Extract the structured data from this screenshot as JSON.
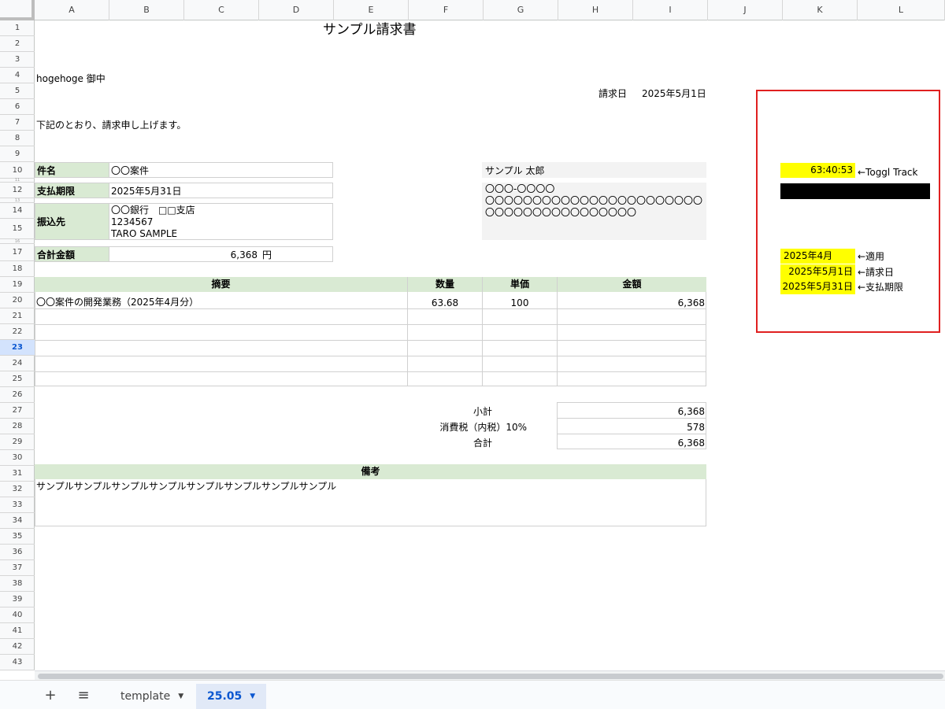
{
  "columns": [
    "A",
    "B",
    "C",
    "D",
    "E",
    "F",
    "G",
    "H",
    "I",
    "J",
    "K",
    "L"
  ],
  "rows": [
    "1",
    "2",
    "3",
    "4",
    "5",
    "6",
    "7",
    "8",
    "9",
    "10",
    "11",
    "12",
    "13",
    "14",
    "15",
    "16",
    "17",
    "18",
    "19",
    "20",
    "21",
    "22",
    "23",
    "24",
    "25",
    "26",
    "27",
    "28",
    "29",
    "30",
    "31",
    "32",
    "33",
    "34",
    "35",
    "36",
    "37",
    "38",
    "39",
    "40",
    "41",
    "42",
    "43"
  ],
  "selected_row": "23",
  "invoice": {
    "title": "サンプル請求書",
    "addressee": "hogehoge 御中",
    "date_label": "請求日",
    "date_value": "2025年5月1日",
    "intro": "下記のとおり、請求申し上げます。",
    "subject_label": "件名",
    "subject_value": "〇〇案件",
    "due_label": "支払期限",
    "due_value": "2025年5月31日",
    "bank_label": "振込先",
    "bank_line1": "〇〇銀行　□□支店",
    "bank_line2": "1234567",
    "bank_line3": "TARO SAMPLE",
    "total_label": "合計金額",
    "total_value": "6,368",
    "total_unit": "円",
    "issuer_name": "サンプル 太郎",
    "issuer_addr1": "〇〇〇-〇〇〇〇",
    "issuer_addr2": "〇〇〇〇〇〇〇〇〇〇〇〇〇〇〇〇〇〇〇〇〇〇〇",
    "issuer_addr3": "〇〇〇〇〇〇〇〇〇〇〇〇〇〇〇〇",
    "table_headers": {
      "desc": "摘要",
      "qty": "数量",
      "price": "単価",
      "amount": "金額"
    },
    "line_item": {
      "desc": "〇〇案件の開発業務（2025年4月分）",
      "qty": "63.68",
      "price": "100",
      "amount": "6,368"
    },
    "subtotal_label": "小計",
    "subtotal_value": "6,368",
    "tax_label": "消費税（内税）10%",
    "tax_value": "578",
    "grand_label": "合計",
    "grand_value": "6,368",
    "notes_label": "備考",
    "notes_value": "サンプルサンプルサンプルサンプルサンプルサンプルサンプルサンプル"
  },
  "side": {
    "hours_value": "63:40:53",
    "hours_note": "←Toggl Track",
    "period_value": "2025年4月",
    "period_note": "←適用",
    "billdate_value": "2025年5月1日",
    "billdate_note": "←請求日",
    "duedate_value": "2025年5月31日",
    "duedate_note": "←支払期限"
  },
  "tabs": {
    "add_label": "+",
    "menu_label": "≡",
    "items": [
      {
        "label": "template"
      },
      {
        "label": "25.05"
      }
    ]
  },
  "colors": {
    "accent": "#0b57d0",
    "header_green": "#d9ead3",
    "highlight_yellow": "#ffff00",
    "frame_red": "#e02020"
  }
}
